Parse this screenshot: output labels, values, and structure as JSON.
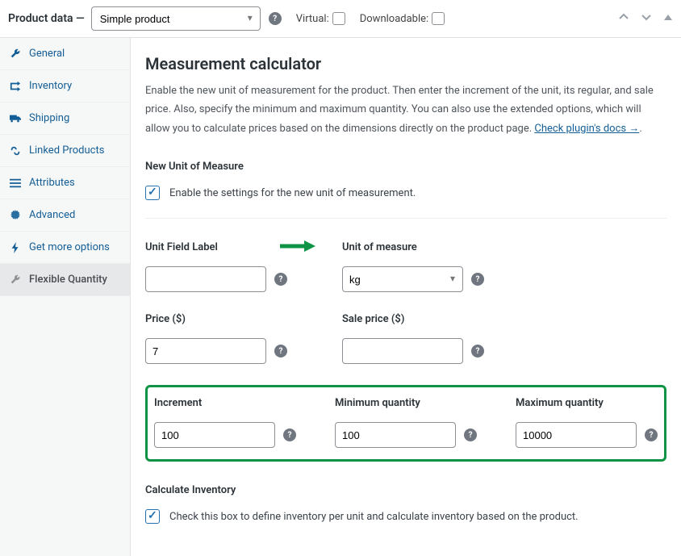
{
  "topbar": {
    "title": "Product data —",
    "product_type": "Simple product",
    "virtual_label": "Virtual:",
    "downloadable_label": "Downloadable:"
  },
  "sidebar": {
    "items": [
      {
        "label": "General",
        "icon": "wrench"
      },
      {
        "label": "Inventory",
        "icon": "clipboard"
      },
      {
        "label": "Shipping",
        "icon": "truck"
      },
      {
        "label": "Linked Products",
        "icon": "link"
      },
      {
        "label": "Attributes",
        "icon": "list"
      },
      {
        "label": "Advanced",
        "icon": "gear"
      },
      {
        "label": "Get more options",
        "icon": "bolt"
      },
      {
        "label": "Flexible Quantity",
        "icon": "wrench"
      }
    ]
  },
  "content": {
    "heading": "Measurement calculator",
    "description": "Enable the new unit of measurement for the product. Then enter the increment of the unit, its regular, and sale price. Also, specify the minimum and maximum quantity. You can also use the extended options, which will allow you to calculate prices based on the dimensions directly on the product page. ",
    "docs_link": "Check plugin's docs →",
    "new_unit": {
      "title": "New Unit of Measure",
      "checkbox_label": "Enable the settings for the new unit of measurement."
    },
    "fields": {
      "unit_field_label": {
        "label": "Unit Field Label",
        "value": ""
      },
      "unit_of_measure": {
        "label": "Unit of measure",
        "value": "kg"
      },
      "price": {
        "label": "Price ($)",
        "value": "7"
      },
      "sale_price": {
        "label": "Sale price ($)",
        "value": ""
      },
      "increment": {
        "label": "Increment",
        "value": "100"
      },
      "min_qty": {
        "label": "Minimum quantity",
        "value": "100"
      },
      "max_qty": {
        "label": "Maximum quantity",
        "value": "10000"
      }
    },
    "calc_inventory": {
      "title": "Calculate Inventory",
      "checkbox_label": "Check this box to define inventory per unit and calculate inventory based on the product."
    }
  }
}
